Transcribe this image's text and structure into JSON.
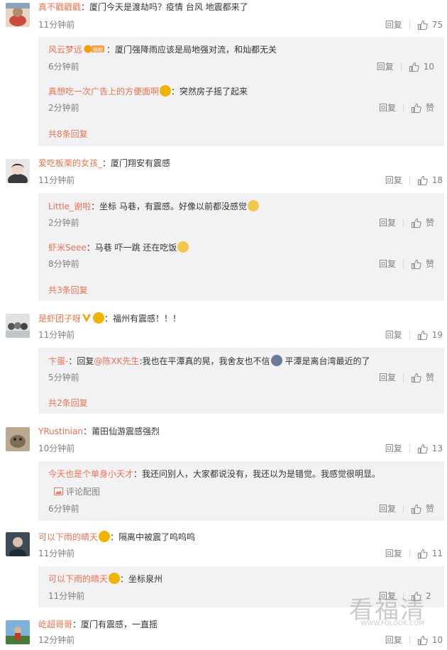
{
  "labels": {
    "reply": "回复",
    "like_zero": "赞",
    "image_comment": "评论配图",
    "colon": "："
  },
  "comments": [
    {
      "user": "真不戳戳戳",
      "text": "厦门今天是渡劫吗？疫情 台风 地震都来了",
      "time": "11分钟前",
      "likes": "75",
      "replies": [
        {
          "user": "风云梦远",
          "text": "厦门强降雨应该是局地强对流，和灿都无关",
          "time": "6分钟前",
          "likes": "10",
          "vip_label": "铁粉"
        },
        {
          "user": "真想吃一次广告上的方便面啊",
          "text": "突然房子摇了起来",
          "time": "2分钟前",
          "likes": "赞"
        }
      ],
      "more": "共8条回复"
    },
    {
      "user": "爱吃板栗的女孩_",
      "text": "厦门翔安有震感",
      "time": "11分钟前",
      "likes": "18",
      "replies": [
        {
          "user": "Little_谢啦",
          "text": "坐标 马巷，有震感。好像以前都没感觉",
          "time": "2分钟前",
          "likes": "赞"
        },
        {
          "user": "虾米Seee",
          "text": "马巷 吓一跳 还在吃饭",
          "time": "8分钟前",
          "likes": "赞"
        }
      ],
      "more": "共3条回复"
    },
    {
      "user": "是虾团子呀",
      "text": "福州有震感！！！",
      "time": "11分钟前",
      "likes": "19",
      "replies": [
        {
          "user": "卞蛋-",
          "text_a": "回复",
          "mention": "@陈XK先生",
          "text_b": ":我也在平潭真的晃，我舍友也不信",
          "text_c": "平潭是离台湾最近的了",
          "time": "5分钟前",
          "likes": "赞"
        }
      ],
      "more": "共2条回复"
    },
    {
      "user": "YRustinian",
      "text": "莆田仙游震感强烈",
      "time": "10分钟前",
      "likes": "13",
      "replies": [
        {
          "user": "今天也是个单身小天才",
          "text": "我还问别人，大家都说没有，我还以为是错觉。我感觉很明显。",
          "time": "6分钟前",
          "likes": "赞"
        }
      ]
    },
    {
      "user": "可以下雨的晴天",
      "text": "隔离中被震了呜呜呜",
      "time": "11分钟前",
      "likes": "11",
      "replies": [
        {
          "user": "可以下雨的晴天",
          "text": "坐标泉州",
          "time": "11分钟前",
          "likes": "2"
        }
      ]
    },
    {
      "user": "屹超哥哥",
      "text": "厦门有震感，一直摇",
      "time": "12分钟前",
      "likes": "10"
    }
  ],
  "watermark": {
    "main": "看福清",
    "sub": "WWW.FQLOOK.COM"
  },
  "colors": {
    "username": "#eb7350",
    "reply_bg": "#f2f2f5",
    "meta": "#808080"
  }
}
